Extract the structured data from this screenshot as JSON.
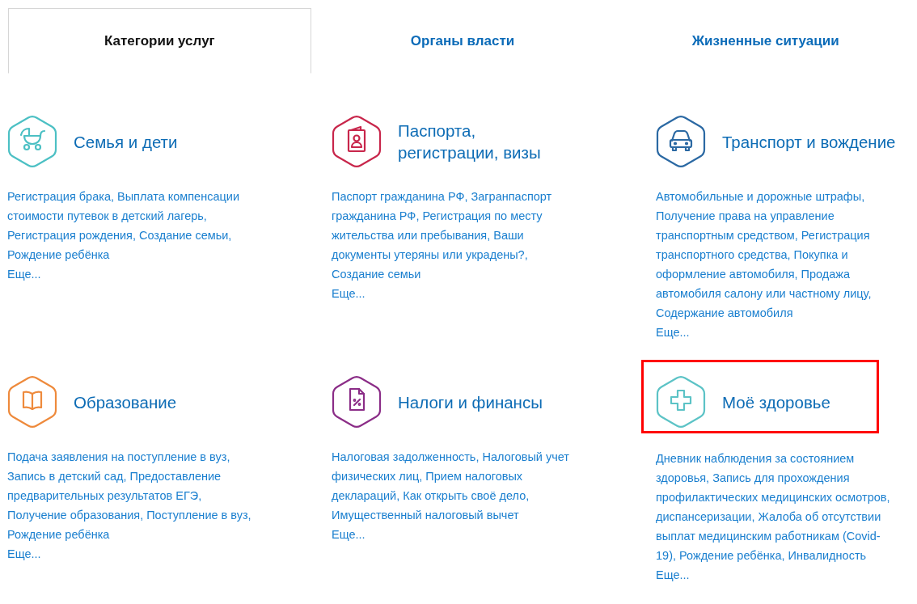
{
  "tabs": [
    {
      "label": "Категории услуг",
      "selected": true
    },
    {
      "label": "Органы власти",
      "selected": false
    },
    {
      "label": "Жизненные ситуации",
      "selected": false
    }
  ],
  "categories": [
    {
      "title": "Семья и дети",
      "color": "#4cc0c4",
      "highlighted": false,
      "services": "Регистрация брака, Выплата компенсации стоимости путевок в детский лагерь, Регистрация рождения, Создание семьи, Рождение ребёнка",
      "more": "Еще..."
    },
    {
      "title": "Паспорта, регистрации, визы",
      "color": "#c8264b",
      "highlighted": false,
      "services": "Паспорт гражданина РФ, Загранпаспорт гражданина РФ, Регистрация по месту жительства или пребывания, Ваши документы утеряны или украдены?, Создание семьи",
      "more": "Еще..."
    },
    {
      "title": "Транспорт и вождение",
      "color": "#2b69a3",
      "highlighted": false,
      "services": "Автомобильные и дорожные штрафы, Получение права на управление транспортным средством, Регистрация транспортного средства, Покупка и оформление автомобиля, Продажа автомобиля салону или частному лицу, Содержание автомобиля",
      "more": "Еще..."
    },
    {
      "title": "Образование",
      "color": "#ee8a3c",
      "highlighted": false,
      "services": "Подача заявления на поступление в вуз, Запись в детский сад, Предоставление предварительных результатов ЕГЭ, Получение образования, Поступление в вуз, Рождение ребёнка",
      "more": "Еще..."
    },
    {
      "title": "Налоги и финансы",
      "color": "#8b2d87",
      "highlighted": false,
      "services": "Налоговая задолженность, Налоговый учет физических лиц, Прием налоговых деклараций, Как открыть своё дело, Имущественный налоговый вычет",
      "more": "Еще..."
    },
    {
      "title": "Моё здоровье",
      "color": "#5cc3c6",
      "highlighted": true,
      "services": "Дневник наблюдения за состоянием здоровья, Запись для прохождения профилактических медицинских осмотров, диспансеризации, Жалоба об отсутствии выплат медицинским работникам (Covid-19), Рождение ребёнка, Инвалидность",
      "more": "Еще..."
    }
  ]
}
